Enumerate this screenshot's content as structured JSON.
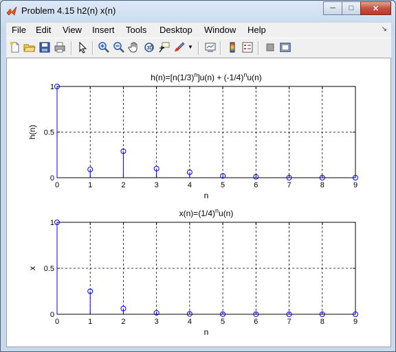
{
  "window": {
    "title": "Problem 4.15 h2(n) x(n)"
  },
  "menubar": {
    "items": [
      "File",
      "Edit",
      "View",
      "Insert",
      "Tools",
      "Desktop",
      "Window",
      "Help"
    ]
  },
  "toolbar": {
    "icons": [
      "new-figure-icon",
      "open-file-icon",
      "save-icon",
      "print-icon",
      "pointer-icon",
      "zoom-in-icon",
      "zoom-out-icon",
      "pan-hand-icon",
      "rotate-3d-icon",
      "data-cursor-icon",
      "brush-icon",
      "brush-dropdown-icon",
      "link-plot-icon",
      "colorbar-icon",
      "legend-icon",
      "hide-plot-tools-icon",
      "show-plot-tools-icon"
    ]
  },
  "colors": {
    "stem": "#0000ff",
    "grid": "#000000",
    "figure_bg": "#ffffff"
  },
  "chart_data": [
    {
      "type": "stem",
      "title_parts": [
        "h(n)=[n(1/3)",
        "n",
        "]u(n) + (-1/4)",
        "n",
        "u(n)"
      ],
      "xlabel": "n",
      "ylabel": "h(n)",
      "x": [
        0,
        1,
        2,
        3,
        4,
        5,
        6,
        7,
        8,
        9
      ],
      "values": [
        1,
        0.09,
        0.29,
        0.1,
        0.06,
        0.02,
        0.01,
        0.0,
        0.0,
        0.0
      ],
      "xlim": [
        0,
        9
      ],
      "ylim": [
        0,
        1
      ],
      "xticks": [
        "0",
        "1",
        "2",
        "3",
        "4",
        "5",
        "6",
        "7",
        "8",
        "9"
      ],
      "yticks": [
        "0",
        "0.5",
        "1"
      ],
      "grid": true
    },
    {
      "type": "stem",
      "title_parts": [
        "x(n)=(1/4)",
        "n",
        "u(n)"
      ],
      "xlabel": "n",
      "ylabel": "x",
      "x": [
        0,
        1,
        2,
        3,
        4,
        5,
        6,
        7,
        8,
        9
      ],
      "values": [
        1,
        0.25,
        0.0625,
        0.0156,
        0.0039,
        0.001,
        0.0002,
        0.0001,
        0.0,
        0.0
      ],
      "xlim": [
        0,
        9
      ],
      "ylim": [
        0,
        1
      ],
      "xticks": [
        "0",
        "1",
        "2",
        "3",
        "4",
        "5",
        "6",
        "7",
        "8",
        "9"
      ],
      "yticks": [
        "0",
        "0.5",
        "1"
      ],
      "grid": true
    }
  ]
}
